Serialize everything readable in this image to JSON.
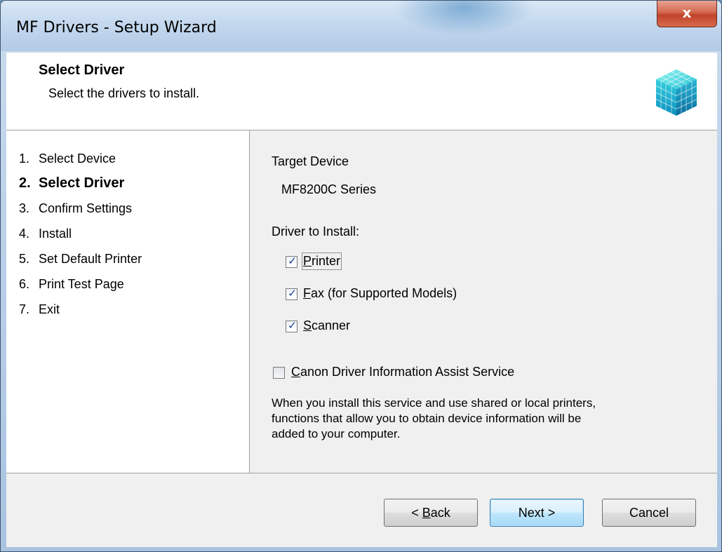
{
  "window": {
    "title": "MF Drivers - Setup Wizard",
    "close_glyph": "x"
  },
  "header": {
    "title": "Select Driver",
    "subtitle": "Select the drivers to install.",
    "logo_icon": "cube-grid-logo"
  },
  "steps": [
    {
      "num": "1.",
      "label": "Select Device",
      "active": false
    },
    {
      "num": "2.",
      "label": "Select Driver",
      "active": true
    },
    {
      "num": "3.",
      "label": "Confirm Settings",
      "active": false
    },
    {
      "num": "4.",
      "label": "Install",
      "active": false
    },
    {
      "num": "5.",
      "label": "Set Default Printer",
      "active": false
    },
    {
      "num": "6.",
      "label": "Print Test Page",
      "active": false
    },
    {
      "num": "7.",
      "label": "Exit",
      "active": false
    }
  ],
  "main": {
    "target_device_label": "Target Device",
    "target_device_value": "MF8200C Series",
    "driver_to_install_label": "Driver to Install:",
    "drivers": [
      {
        "mnemonic": "P",
        "rest": "rinter",
        "checked": true
      },
      {
        "mnemonic": "F",
        "rest": "ax (for Supported Models)",
        "checked": true
      },
      {
        "mnemonic": "S",
        "rest": "canner",
        "checked": true
      }
    ],
    "assist_service": {
      "mnemonic": "C",
      "rest": "anon Driver Information Assist Service",
      "checked": false
    },
    "description_lines": [
      "When you install this service and use shared or local printers,",
      "functions that allow you to obtain device information will be",
      "added to your computer."
    ]
  },
  "buttons": {
    "back_prefix": "< ",
    "back_mnemonic": "B",
    "back_rest": "ack",
    "next": "Next >",
    "cancel": "Cancel"
  },
  "colors": {
    "close_button": "#c0432a",
    "default_button": "#a7d9f5",
    "checkmark": "#1f3c88"
  }
}
